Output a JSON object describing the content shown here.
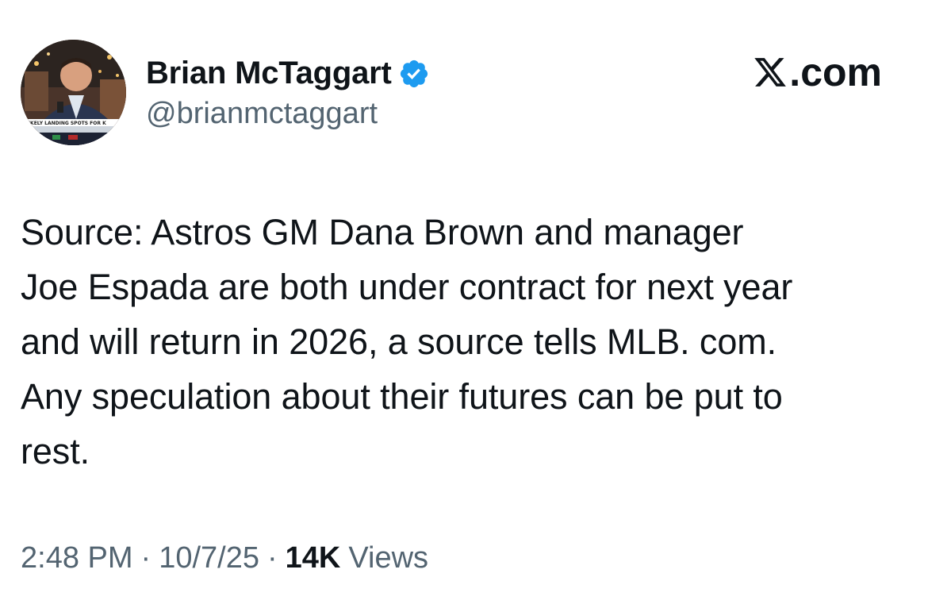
{
  "author": {
    "display_name": "Brian McTaggart",
    "handle": "@brianmctaggart",
    "verified": true,
    "avatar_icon": "profile-photo",
    "avatar_caption": "LIKELY LANDING SPOTS FOR K"
  },
  "brand": {
    "logo_label": ".com",
    "logo_icon": "x-logo-icon"
  },
  "tweet": {
    "text": "Source: Astros GM Dana Brown and manager\nJoe Espada are both under contract for next year\nand will return in 2026, a source tells MLB. com.\nAny speculation about their futures can be put to\nrest."
  },
  "meta": {
    "time": "2:48 PM",
    "separator": "·",
    "date": "10/7/25",
    "views_count": "14K",
    "views_label": "Views"
  },
  "colors": {
    "text_primary": "#0f1419",
    "text_secondary": "#536471",
    "verified_blue": "#1d9bf0"
  }
}
